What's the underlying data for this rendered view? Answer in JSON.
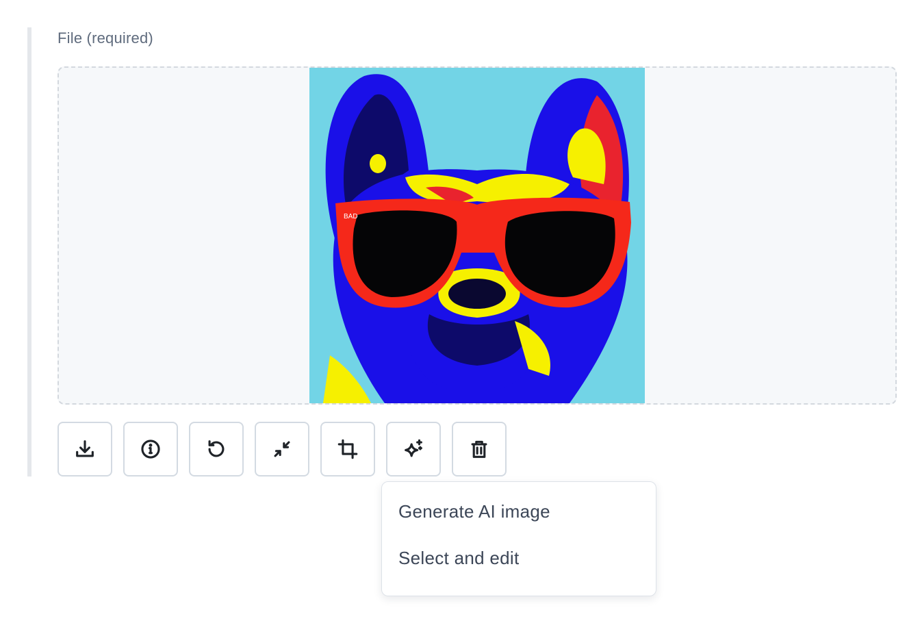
{
  "field": {
    "label": "File (required)"
  },
  "preview": {
    "icon": "pop-art-dog-image"
  },
  "toolbar": {
    "buttons": [
      {
        "name": "download",
        "icon": "download-icon"
      },
      {
        "name": "info",
        "icon": "info-icon"
      },
      {
        "name": "replace",
        "icon": "rotate-ccw-icon"
      },
      {
        "name": "minimize",
        "icon": "minimize-icon"
      },
      {
        "name": "crop",
        "icon": "crop-icon"
      },
      {
        "name": "ai",
        "icon": "sparkles-icon"
      },
      {
        "name": "delete",
        "icon": "trash-icon"
      }
    ]
  },
  "ai_menu": {
    "items": [
      {
        "label": "Generate AI image"
      },
      {
        "label": "Select and edit"
      }
    ]
  },
  "colors": {
    "label": "#5f6b7d",
    "border": "#d3dae2",
    "dropzone_bg": "#f6f8fa",
    "menu_text": "#3c4657"
  }
}
